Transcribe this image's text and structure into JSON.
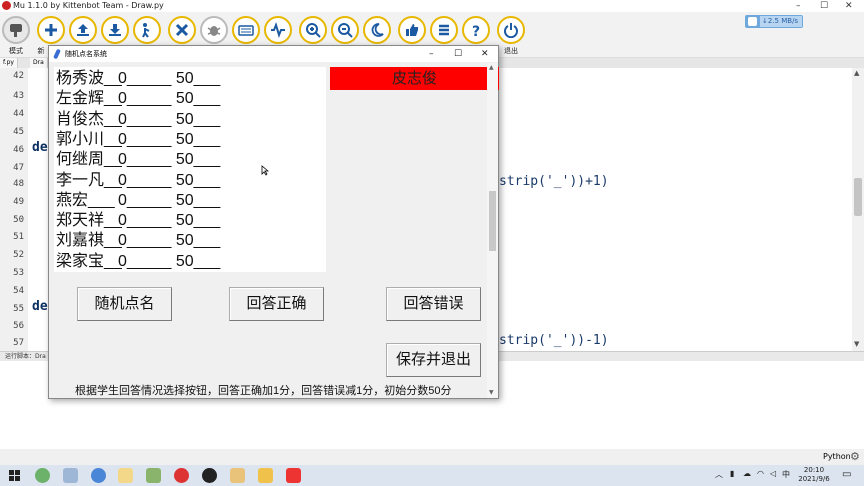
{
  "mu": {
    "title": "Mu 1.1.0 by Kittenbot Team - Draw.py",
    "toolbar_labels": {
      "mode": "模式",
      "new": "新",
      "exit": "退出"
    },
    "net_speed": "↓2.5 MB/s",
    "tabs": [
      "f.py",
      "Dra"
    ],
    "line_numbers": [
      "42",
      "43",
      "44",
      "45",
      "46",
      "47",
      "48",
      "49",
      "50",
      "51",
      "52",
      "53",
      "54",
      "55",
      "56",
      "57"
    ],
    "code_fragments": {
      "def_1": "de",
      "def_2": "de",
      "line_48": "strip('_'))+1)",
      "line_56": "strip('_'))-1)"
    },
    "run_label": "运行脚本：Dra",
    "status_language": "Python"
  },
  "taskbar": {
    "time": "20:10",
    "date": "2021/9/6",
    "ime": "中"
  },
  "app": {
    "title": "随机点名系统",
    "window_controls": {
      "minimize": "–",
      "maximize": "☐",
      "close": "✕"
    },
    "students": [
      {
        "name": "杨秀波__",
        "score": "0_____ 50___"
      },
      {
        "name": "左金辉__",
        "score": "0_____ 50___"
      },
      {
        "name": "肖俊杰__",
        "score": "0_____ 50___"
      },
      {
        "name": "郭小川__",
        "score": "0_____ 50___"
      },
      {
        "name": "何继周__",
        "score": "0_____ 50___"
      },
      {
        "name": "李一凡__",
        "score": "0_____ 50___"
      },
      {
        "name": "燕宏___",
        "score": "0_____ 50___"
      },
      {
        "name": "郑天祥__",
        "score": "0_____ 50___"
      },
      {
        "name": "刘嘉祺__",
        "score": "0_____ 50___"
      },
      {
        "name": "梁家宝__",
        "score": "0_____ 50___"
      }
    ],
    "picked_name": "皮志俊",
    "buttons": {
      "random": "随机点名",
      "correct": "回答正确",
      "wrong": "回答错误",
      "save_exit": "保存并退出"
    },
    "hint": "根据学生回答情况选择按钮，回答正确加1分，回答错误减1分，初始分数50分"
  }
}
